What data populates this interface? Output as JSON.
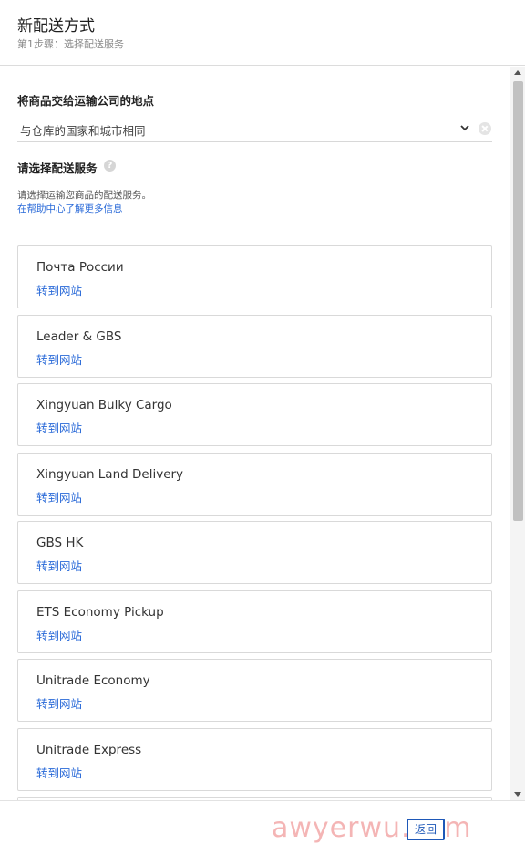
{
  "header": {
    "title": "新配送方式",
    "subtitle": "第1步骤：选择配送服务"
  },
  "handover": {
    "label": "将商品交给运输公司的地点",
    "selected": "与仓库的国家和城市相同"
  },
  "service": {
    "label": "请选择配送服务",
    "description": "请选择运输您商品的配送服务。",
    "help_link": "在帮助中心了解更多信息"
  },
  "cards": [
    {
      "name": "Почта России",
      "link": "转到网站"
    },
    {
      "name": "Leader & GBS",
      "link": "转到网站"
    },
    {
      "name": "Xingyuan Bulky Cargo",
      "link": "转到网站"
    },
    {
      "name": "Xingyuan Land Delivery",
      "link": "转到网站"
    },
    {
      "name": "GBS HK",
      "link": "转到网站"
    },
    {
      "name": "ETS Economy Pickup",
      "link": "转到网站"
    },
    {
      "name": "Unitrade Economy",
      "link": "转到网站"
    },
    {
      "name": "Unitrade Express",
      "link": "转到网站"
    }
  ],
  "footer": {
    "back_label": "返回",
    "watermark": "awyerwu.com"
  },
  "icons": {
    "help": "question-circle-icon",
    "dropdown": "chevron-down-icon",
    "clear": "clear-icon"
  },
  "colors": {
    "link": "#2a6ad8",
    "primary_button": "#1e58b8"
  }
}
